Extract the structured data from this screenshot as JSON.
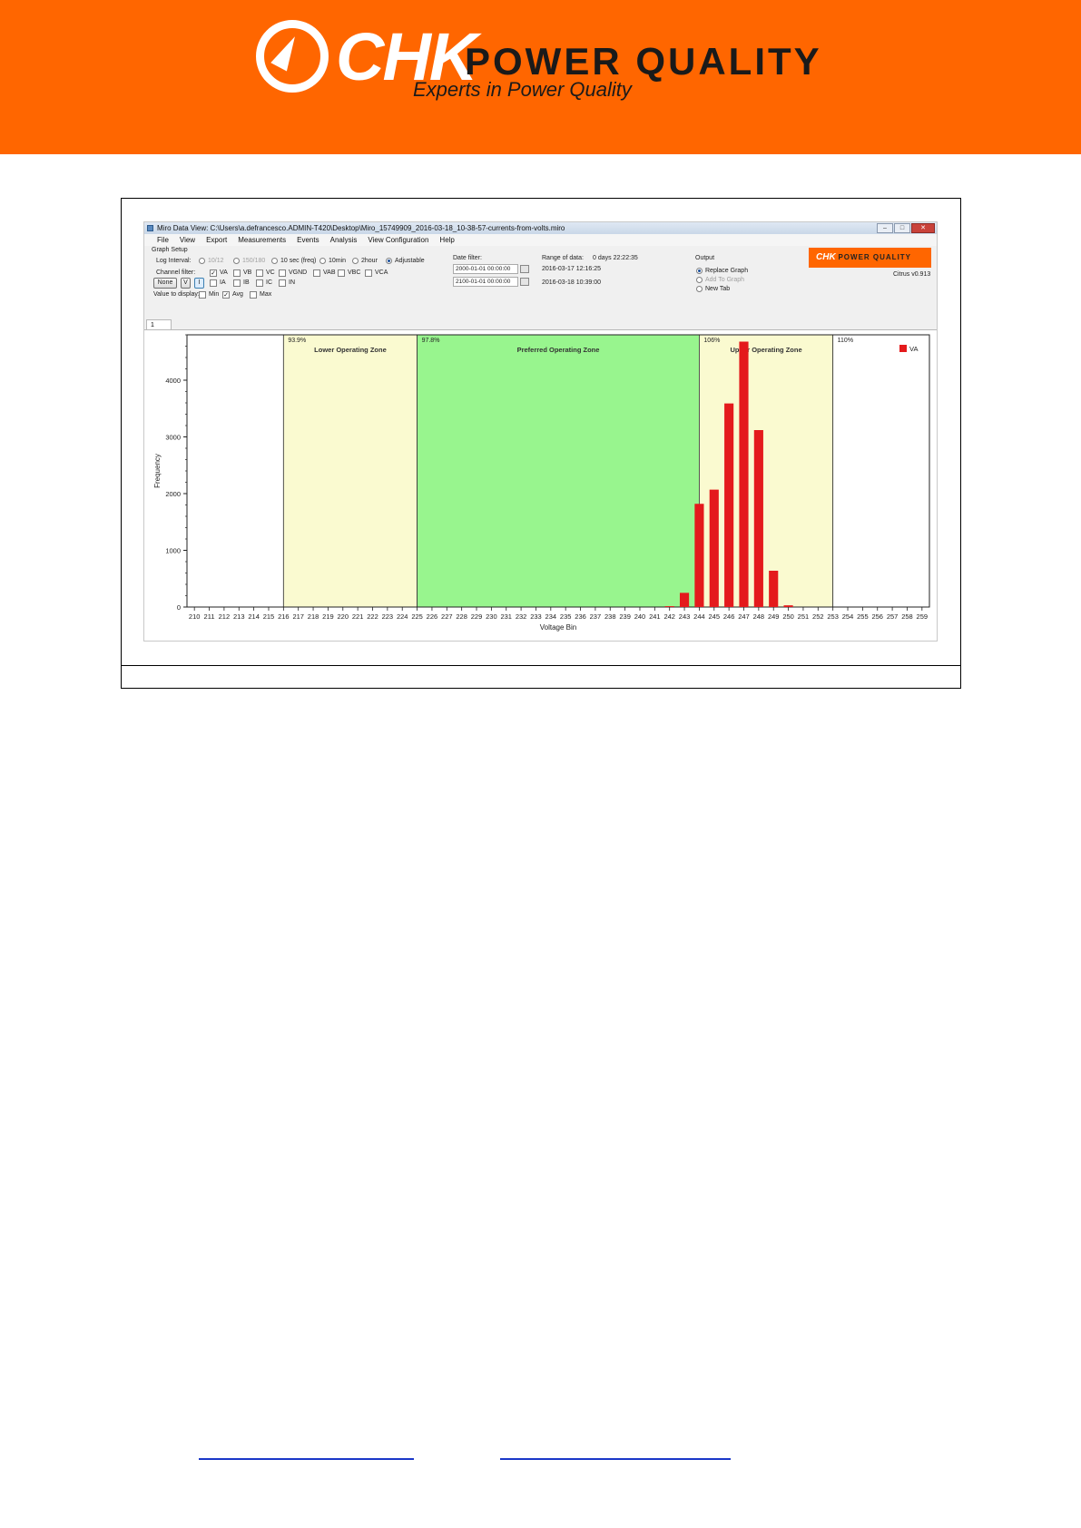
{
  "banner": {
    "brand": "CHK",
    "product": "POWER QUALITY",
    "tagline": "Experts in Power Quality",
    "color": "#ff6600"
  },
  "window": {
    "title": "Miro Data View: C:\\Users\\a.defrancesco.ADMIN-T420\\Desktop\\Miro_15749909_2016-03-18_10-38-57-currents-from-volts.miro",
    "buttons": [
      "–",
      "□",
      "✕"
    ]
  },
  "menu": [
    "File",
    "View",
    "Export",
    "Measurements",
    "Events",
    "Analysis",
    "View Configuration",
    "Help"
  ],
  "graph_setup": {
    "group_label": "Graph Setup",
    "log_interval_label": "Log Interval:",
    "log_intervals": [
      "10/12",
      "150/180",
      "10 sec (freq)",
      "10min",
      "2hour",
      "Adjustable"
    ],
    "log_interval_selected": "Adjustable",
    "channel_filter_label": "Channel filter:",
    "channel_buttons": [
      "None",
      "V",
      "I"
    ],
    "channels_row1": [
      {
        "name": "VA",
        "checked": true
      },
      {
        "name": "VB",
        "checked": false
      },
      {
        "name": "VC",
        "checked": false
      },
      {
        "name": "VGND",
        "checked": false
      },
      {
        "name": "VAB",
        "checked": false
      },
      {
        "name": "VBC",
        "checked": false
      },
      {
        "name": "VCA",
        "checked": false
      }
    ],
    "channels_row2": [
      {
        "name": "IA",
        "checked": false
      },
      {
        "name": "IB",
        "checked": false
      },
      {
        "name": "IC",
        "checked": false
      },
      {
        "name": "IN",
        "checked": false
      }
    ],
    "value_to_display_label": "Value to display:",
    "values": [
      {
        "name": "Min",
        "checked": false
      },
      {
        "name": "Avg",
        "checked": true
      },
      {
        "name": "Max",
        "checked": false
      }
    ],
    "date_filter_label": "Date filter:",
    "date_from": "2000-01-01 00:00:00",
    "date_to": "2100-01-01 00:00:00",
    "range_label": "Range of data:",
    "range_duration": "0 days 22:22:35",
    "range_start": "2016-03-17 12:16:25",
    "range_end": "2016-03-18 10:39:00",
    "output_label": "Output",
    "output_options": [
      "Replace Graph",
      "Add To Graph",
      "New Tab"
    ],
    "output_selected": "Replace Graph",
    "version": "Citrus v0.913",
    "mini_logo_brand": "CHK",
    "mini_logo_product": "POWER QUALITY",
    "tab_label": "1"
  },
  "chart_data": {
    "type": "bar",
    "xlabel": "Voltage Bin",
    "ylabel": "Frequency",
    "ylim": [
      0,
      4800
    ],
    "yticks": [
      0,
      1000,
      2000,
      3000,
      4000
    ],
    "categories": [
      "210",
      "211",
      "212",
      "213",
      "214",
      "215",
      "216",
      "217",
      "218",
      "219",
      "220",
      "221",
      "222",
      "223",
      "224",
      "225",
      "226",
      "227",
      "228",
      "229",
      "230",
      "231",
      "232",
      "233",
      "234",
      "235",
      "236",
      "237",
      "238",
      "239",
      "240",
      "241",
      "242",
      "243",
      "244",
      "245",
      "246",
      "247",
      "248",
      "249",
      "250",
      "251",
      "252",
      "253",
      "254",
      "255",
      "256",
      "257",
      "258",
      "259"
    ],
    "series": [
      {
        "name": "VA",
        "color": "#e41a1c",
        "values": [
          0,
          0,
          0,
          0,
          0,
          0,
          0,
          0,
          0,
          0,
          0,
          0,
          0,
          0,
          0,
          0,
          0,
          0,
          0,
          0,
          0,
          0,
          0,
          0,
          0,
          0,
          0,
          0,
          0,
          0,
          0,
          0,
          15,
          250,
          1820,
          2070,
          3590,
          4680,
          3120,
          640,
          30,
          0,
          0,
          0,
          0,
          0,
          0,
          0,
          0,
          0
        ]
      }
    ],
    "zones": [
      {
        "label": "",
        "percent": "",
        "from": 209.5,
        "to": 216,
        "color": "#ffffff"
      },
      {
        "label": "Lower Operating Zone",
        "percent": "93.9%",
        "from": 216,
        "to": 225,
        "color": "#fafad0"
      },
      {
        "label": "Preferred Operating Zone",
        "percent": "97.8%",
        "from": 225,
        "to": 244,
        "color": "#98f58e"
      },
      {
        "label": "Upper Operating Zone",
        "percent": "106%",
        "from": 244,
        "to": 253,
        "color": "#fafad0"
      },
      {
        "label": "",
        "percent": "110%",
        "from": 253,
        "to": 259.5,
        "color": "#ffffff"
      }
    ],
    "legend": "top-right"
  }
}
